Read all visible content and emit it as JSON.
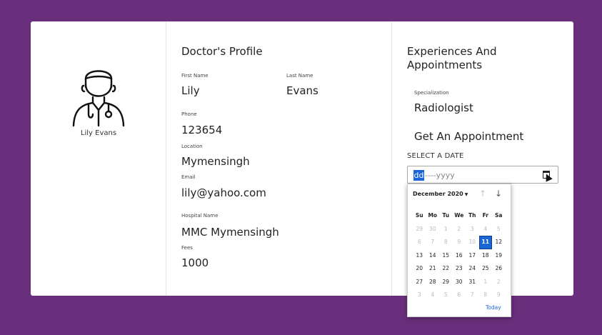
{
  "profile": {
    "name": "Lily Evans"
  },
  "doctor": {
    "title": "Doctor's Profile",
    "first_name_label": "First Name",
    "first_name": "Lily",
    "last_name_label": "Last Name",
    "last_name": "Evans",
    "phone_label": "Phone",
    "phone": "123654",
    "location_label": "Location",
    "location": "Mymensingh",
    "email_label": "Email",
    "email": "lily@yahoo.com",
    "hospital_label": "Hospital Name",
    "hospital": "MMC Mymensingh",
    "fees_label": "Fees",
    "fees": "1000"
  },
  "experience": {
    "title": "Experiences And Appointments",
    "specialization_label": "Specialization",
    "specialization": "Radiologist",
    "appointment_title": "Get An Appointment",
    "date_label": "SELECT A DATE",
    "date_day": "dd",
    "date_rest": "----yyyy"
  },
  "calendar": {
    "month": "December 2020",
    "weekdays": [
      "Su",
      "Mo",
      "Tu",
      "We",
      "Th",
      "Fr",
      "Sa"
    ],
    "weeks": [
      [
        "29",
        "30",
        "1",
        "2",
        "3",
        "4",
        "5"
      ],
      [
        "6",
        "7",
        "8",
        "9",
        "10",
        "11",
        "12"
      ],
      [
        "13",
        "14",
        "15",
        "16",
        "17",
        "18",
        "19"
      ],
      [
        "20",
        "21",
        "22",
        "23",
        "24",
        "25",
        "26"
      ],
      [
        "27",
        "28",
        "29",
        "30",
        "31",
        "1",
        "2"
      ],
      [
        "3",
        "4",
        "5",
        "6",
        "7",
        "8",
        "9"
      ]
    ],
    "outside": [
      [
        0,
        0
      ],
      [
        0,
        1
      ],
      [
        0,
        2
      ],
      [
        0,
        3
      ],
      [
        0,
        4
      ],
      [
        0,
        5
      ],
      [
        0,
        6
      ],
      [
        1,
        0
      ],
      [
        1,
        1
      ],
      [
        1,
        2
      ],
      [
        1,
        3
      ],
      [
        1,
        4
      ],
      [
        4,
        5
      ],
      [
        4,
        6
      ],
      [
        5,
        0
      ],
      [
        5,
        1
      ],
      [
        5,
        2
      ],
      [
        5,
        3
      ],
      [
        5,
        4
      ],
      [
        5,
        5
      ],
      [
        5,
        6
      ]
    ],
    "selected": [
      1,
      5
    ],
    "today_label": "Today",
    "colors": {
      "accent": "#1a66d6",
      "background": "#6a2f7c"
    }
  }
}
